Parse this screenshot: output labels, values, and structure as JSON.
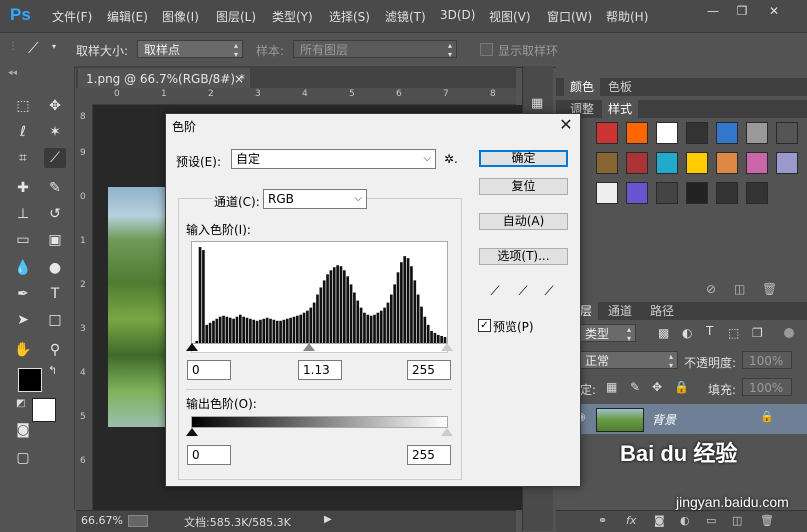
{
  "app": {
    "logo": "Ps",
    "menu": [
      "文件(F)",
      "编辑(E)",
      "图像(I)",
      "图层(L)",
      "类型(Y)",
      "选择(S)",
      "滤镜(T)",
      "3D(D)",
      "视图(V)",
      "窗口(W)",
      "帮助(H)"
    ],
    "window_buttons": {
      "minimize": "—",
      "restore": "❐",
      "close": "✕"
    }
  },
  "options_bar": {
    "sample_size_label": "取样大小:",
    "sample_size_value": "取样点",
    "sample_label": "样本:",
    "sample_value": "所有图层",
    "show_ring_label": "显示取样环"
  },
  "document": {
    "tab_title": "1.png @ 66.7%(RGB/8#) *",
    "tab_close": "×",
    "ruler_top_ticks": [
      "0",
      "1",
      "2",
      "3",
      "4",
      "5",
      "6",
      "7",
      "8"
    ],
    "ruler_left_ticks": [
      "8",
      "9",
      "0",
      "1",
      "2",
      "3",
      "4",
      "5",
      "6"
    ],
    "zoom": "66.67%",
    "doc_size": "文档:585.3K/585.3K"
  },
  "panels": {
    "top_tabs": [
      "颜色",
      "色板"
    ],
    "style_tabs": [
      "调整",
      "样式"
    ],
    "layer_tabs": [
      "层",
      "通道",
      "路径"
    ],
    "kind_label": "类型",
    "blend_mode": "正常",
    "opacity_label": "不透明度:",
    "opacity_value": "100%",
    "lock_label": "定:",
    "fill_label": "填充:",
    "fill_value": "100%",
    "layer_name": "背景",
    "swatch_colors": [
      "#cc3333",
      "#ff6600",
      "#ffffff",
      "#333333",
      "#3377cc",
      "#999999",
      "#555555",
      "#886633",
      "#aa3333",
      "#22aacc",
      "#ffcc00",
      "#dd8844",
      "#cc66aa",
      "#9999cc",
      "#eeeeee",
      "#6655cc",
      "#444444",
      "#222222",
      "#333333",
      "#333333"
    ]
  },
  "dialog": {
    "title": "色阶",
    "close": "✕",
    "preset_label": "预设(E):",
    "preset_value": "自定",
    "gear": "✲.",
    "channel_label": "通道(C):",
    "channel_value": "RGB",
    "input_levels_label": "输入色阶(I):",
    "input_black": "0",
    "input_gamma": "1.13",
    "input_white": "255",
    "output_levels_label": "输出色阶(O):",
    "output_black": "0",
    "output_white": "255",
    "buttons": {
      "ok": "确定",
      "reset": "复位",
      "auto": "自动(A)",
      "options": "选项(T)..."
    },
    "preview_label": "预览(P)",
    "preview_checked": true
  },
  "chart_data": {
    "type": "bar",
    "title": "",
    "histogram": [
      0,
      2,
      95,
      92,
      18,
      20,
      22,
      24,
      26,
      27,
      26,
      25,
      24,
      26,
      28,
      26,
      25,
      24,
      23,
      22,
      23,
      24,
      25,
      24,
      23,
      22,
      22,
      23,
      24,
      25,
      26,
      27,
      28,
      30,
      32,
      35,
      40,
      48,
      55,
      62,
      68,
      72,
      75,
      77,
      76,
      72,
      66,
      58,
      50,
      42,
      35,
      30,
      28,
      27,
      28,
      30,
      32,
      35,
      40,
      48,
      58,
      70,
      80,
      86,
      84,
      76,
      62,
      48,
      36,
      26,
      18,
      12,
      10,
      8,
      7,
      6
    ],
    "xlim": [
      0,
      255
    ]
  },
  "watermark": {
    "brand": "Bai du 经验",
    "url": "jingyan.baidu.com"
  }
}
